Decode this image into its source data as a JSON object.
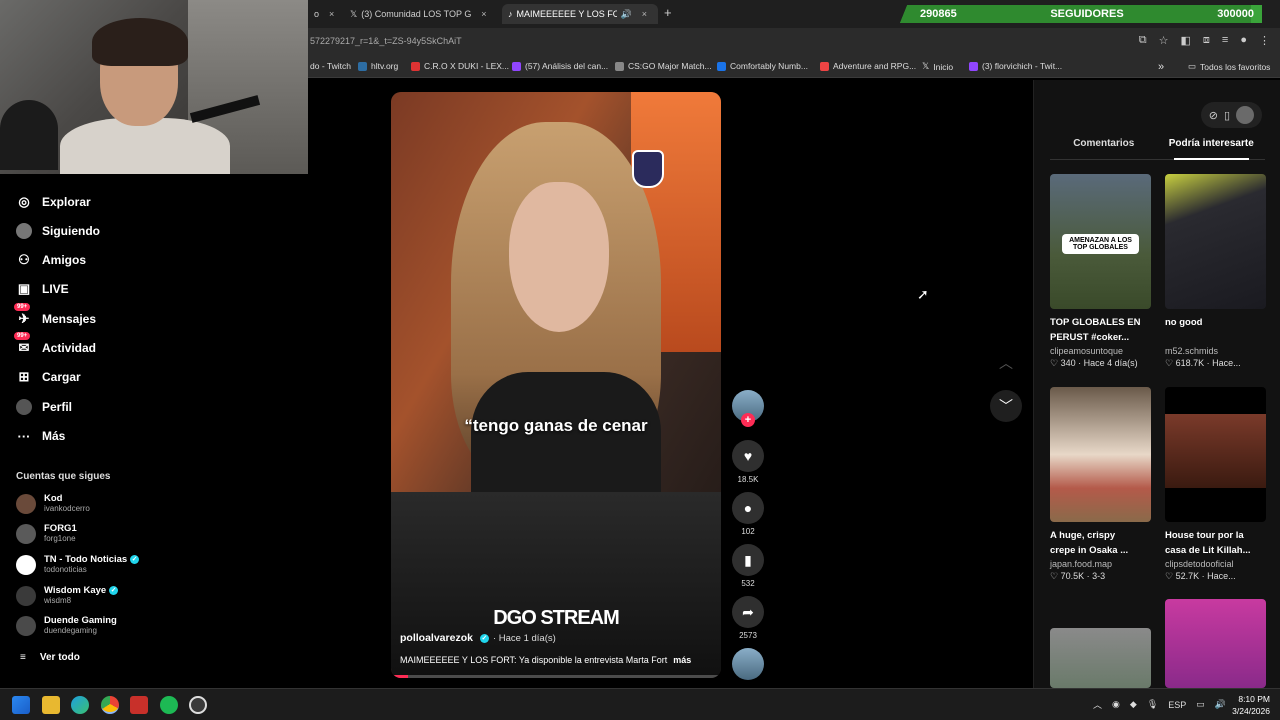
{
  "tabs": [
    {
      "label": "o",
      "close": "×"
    },
    {
      "label": "(3) Comunidad LOS TOP GLOBALE",
      "close": "×"
    },
    {
      "label": "MAIMEEEEEE Y LOS FORT",
      "close": "×"
    }
  ],
  "new_tab": "+",
  "followers": {
    "current": "290865",
    "label": "SEGUIDORES",
    "goal": "300000",
    "progress": 0.9696
  },
  "address_bar": {
    "url": "572279217_r=1&_t=ZS-94y5SkChAiT"
  },
  "bookmarks": [
    {
      "label": "do - Twitch",
      "color": "#9146ff"
    },
    {
      "label": "hltv.org",
      "color": "#2d6da3"
    },
    {
      "label": "C.R.O X DUKI - LEX...",
      "color": "#d33"
    },
    {
      "label": "(57) Análisis del can...",
      "color": "#9146ff"
    },
    {
      "label": "CS:GO Major Match...",
      "color": "#888"
    },
    {
      "label": "Comfortably Numb...",
      "color": "#1a73e8"
    },
    {
      "label": "Adventure and RPG...",
      "color": "#e44"
    },
    {
      "label": "Inicio",
      "color": "#000"
    },
    {
      "label": "(3) florvichich - Twit...",
      "color": "#9146ff"
    }
  ],
  "bookmarks_more": "»",
  "all_bookmarks": "Todos los favoritos",
  "sidebar": {
    "nav": [
      {
        "label": "Explorar",
        "icon": "compass-icon",
        "glyph": "◎"
      },
      {
        "label": "Siguiendo",
        "icon": "following-icon",
        "glyph": "●"
      },
      {
        "label": "Amigos",
        "icon": "friends-icon",
        "glyph": "⚇"
      },
      {
        "label": "LIVE",
        "icon": "live-icon",
        "glyph": "▣"
      },
      {
        "label": "Mensajes",
        "icon": "messages-icon",
        "glyph": "✈",
        "badge": "99+"
      },
      {
        "label": "Actividad",
        "icon": "activity-icon",
        "glyph": "✉",
        "badge": "99+"
      },
      {
        "label": "Cargar",
        "icon": "upload-icon",
        "glyph": "⊞"
      },
      {
        "label": "Perfil",
        "icon": "profile-icon",
        "glyph": "●"
      },
      {
        "label": "Más",
        "icon": "more-icon",
        "glyph": "···"
      }
    ],
    "following_title": "Cuentas que sigues",
    "following": [
      {
        "name": "Kod",
        "handle": "ivankodcerro",
        "verified": false,
        "color": "#6a4a3a"
      },
      {
        "name": "FORG1",
        "handle": "forg1one",
        "verified": false,
        "color": "#5a5a5a"
      },
      {
        "name": "TN - Todo Noticias",
        "handle": "todonoticias",
        "verified": true,
        "color": "#ffffff"
      },
      {
        "name": "Wisdom Kaye",
        "handle": "wisdm8",
        "verified": true,
        "color": "#3a3a3a"
      },
      {
        "name": "Duende Gaming",
        "handle": "duendegaming",
        "verified": false,
        "color": "#4a4a4a"
      }
    ],
    "see_all": "Ver todo"
  },
  "video": {
    "caption": "“tengo ganas de cenar",
    "watermark": "DGO STREAM",
    "author": "polloalvarezok",
    "time": "· Hace 1 día(s)",
    "description": "MAIMEEEEEE Y LOS FORT: Ya disponible la entrevista Marta Fort",
    "more": "más",
    "progress": 0.05
  },
  "actions": {
    "likes": "18.5K",
    "comments": "102",
    "saves": "532",
    "shares": "2573"
  },
  "right_panel": {
    "tabs": [
      "Comentarios",
      "Podría interesarte"
    ],
    "active_tab": 1,
    "cards": [
      {
        "title": "TOP GLOBALES EN PERUST #coker...",
        "user": "clipeamosuntoque",
        "meta": "♡ 340 · Hace 4 día(s)",
        "overlay": "AMENAZAN A LOS TOP GLOBALES",
        "bg": "linear-gradient(180deg,#5a6a7a,#4a5a3a 60%,#3a4a2a)"
      },
      {
        "title": "no good",
        "user": "m52.schmids",
        "meta": "♡ 618.7K · Hace...",
        "overlay": "",
        "bg": "linear-gradient(160deg,#c8d040 0%,#2a2a30 30%,#1a1a20 100%)"
      },
      {
        "title": "A huge, crispy crepe in Osaka ...",
        "user": "japan.food.map",
        "meta": "♡ 70.5K · 3-3",
        "overlay": "",
        "bg": "linear-gradient(180deg,#6a5a4a,#e8d8c8 50%,#b45a4a 75%,#8a6a4a)"
      },
      {
        "title": "House tour por la casa de Lit Killah...",
        "user": "clipsdetodooficial",
        "meta": "♡ 52.7K · Hace...",
        "overlay": "",
        "bg": "linear-gradient(180deg,#000 0%,#000 20%,#7a3a2a 20%,#3a1a10 75%,#000 75%)"
      },
      {
        "title": "",
        "user": "",
        "meta": "",
        "overlay": "",
        "bg": "linear-gradient(180deg,#8a8a8a,#6a7a6a)"
      },
      {
        "title": "",
        "user": "",
        "meta": "",
        "overlay": "",
        "bg": "linear-gradient(180deg,#c83aa0,#8a2a8a)"
      }
    ]
  },
  "taskbar": {
    "lang": "ESP",
    "time": "8:10 PM",
    "date": "3/24/2026"
  }
}
